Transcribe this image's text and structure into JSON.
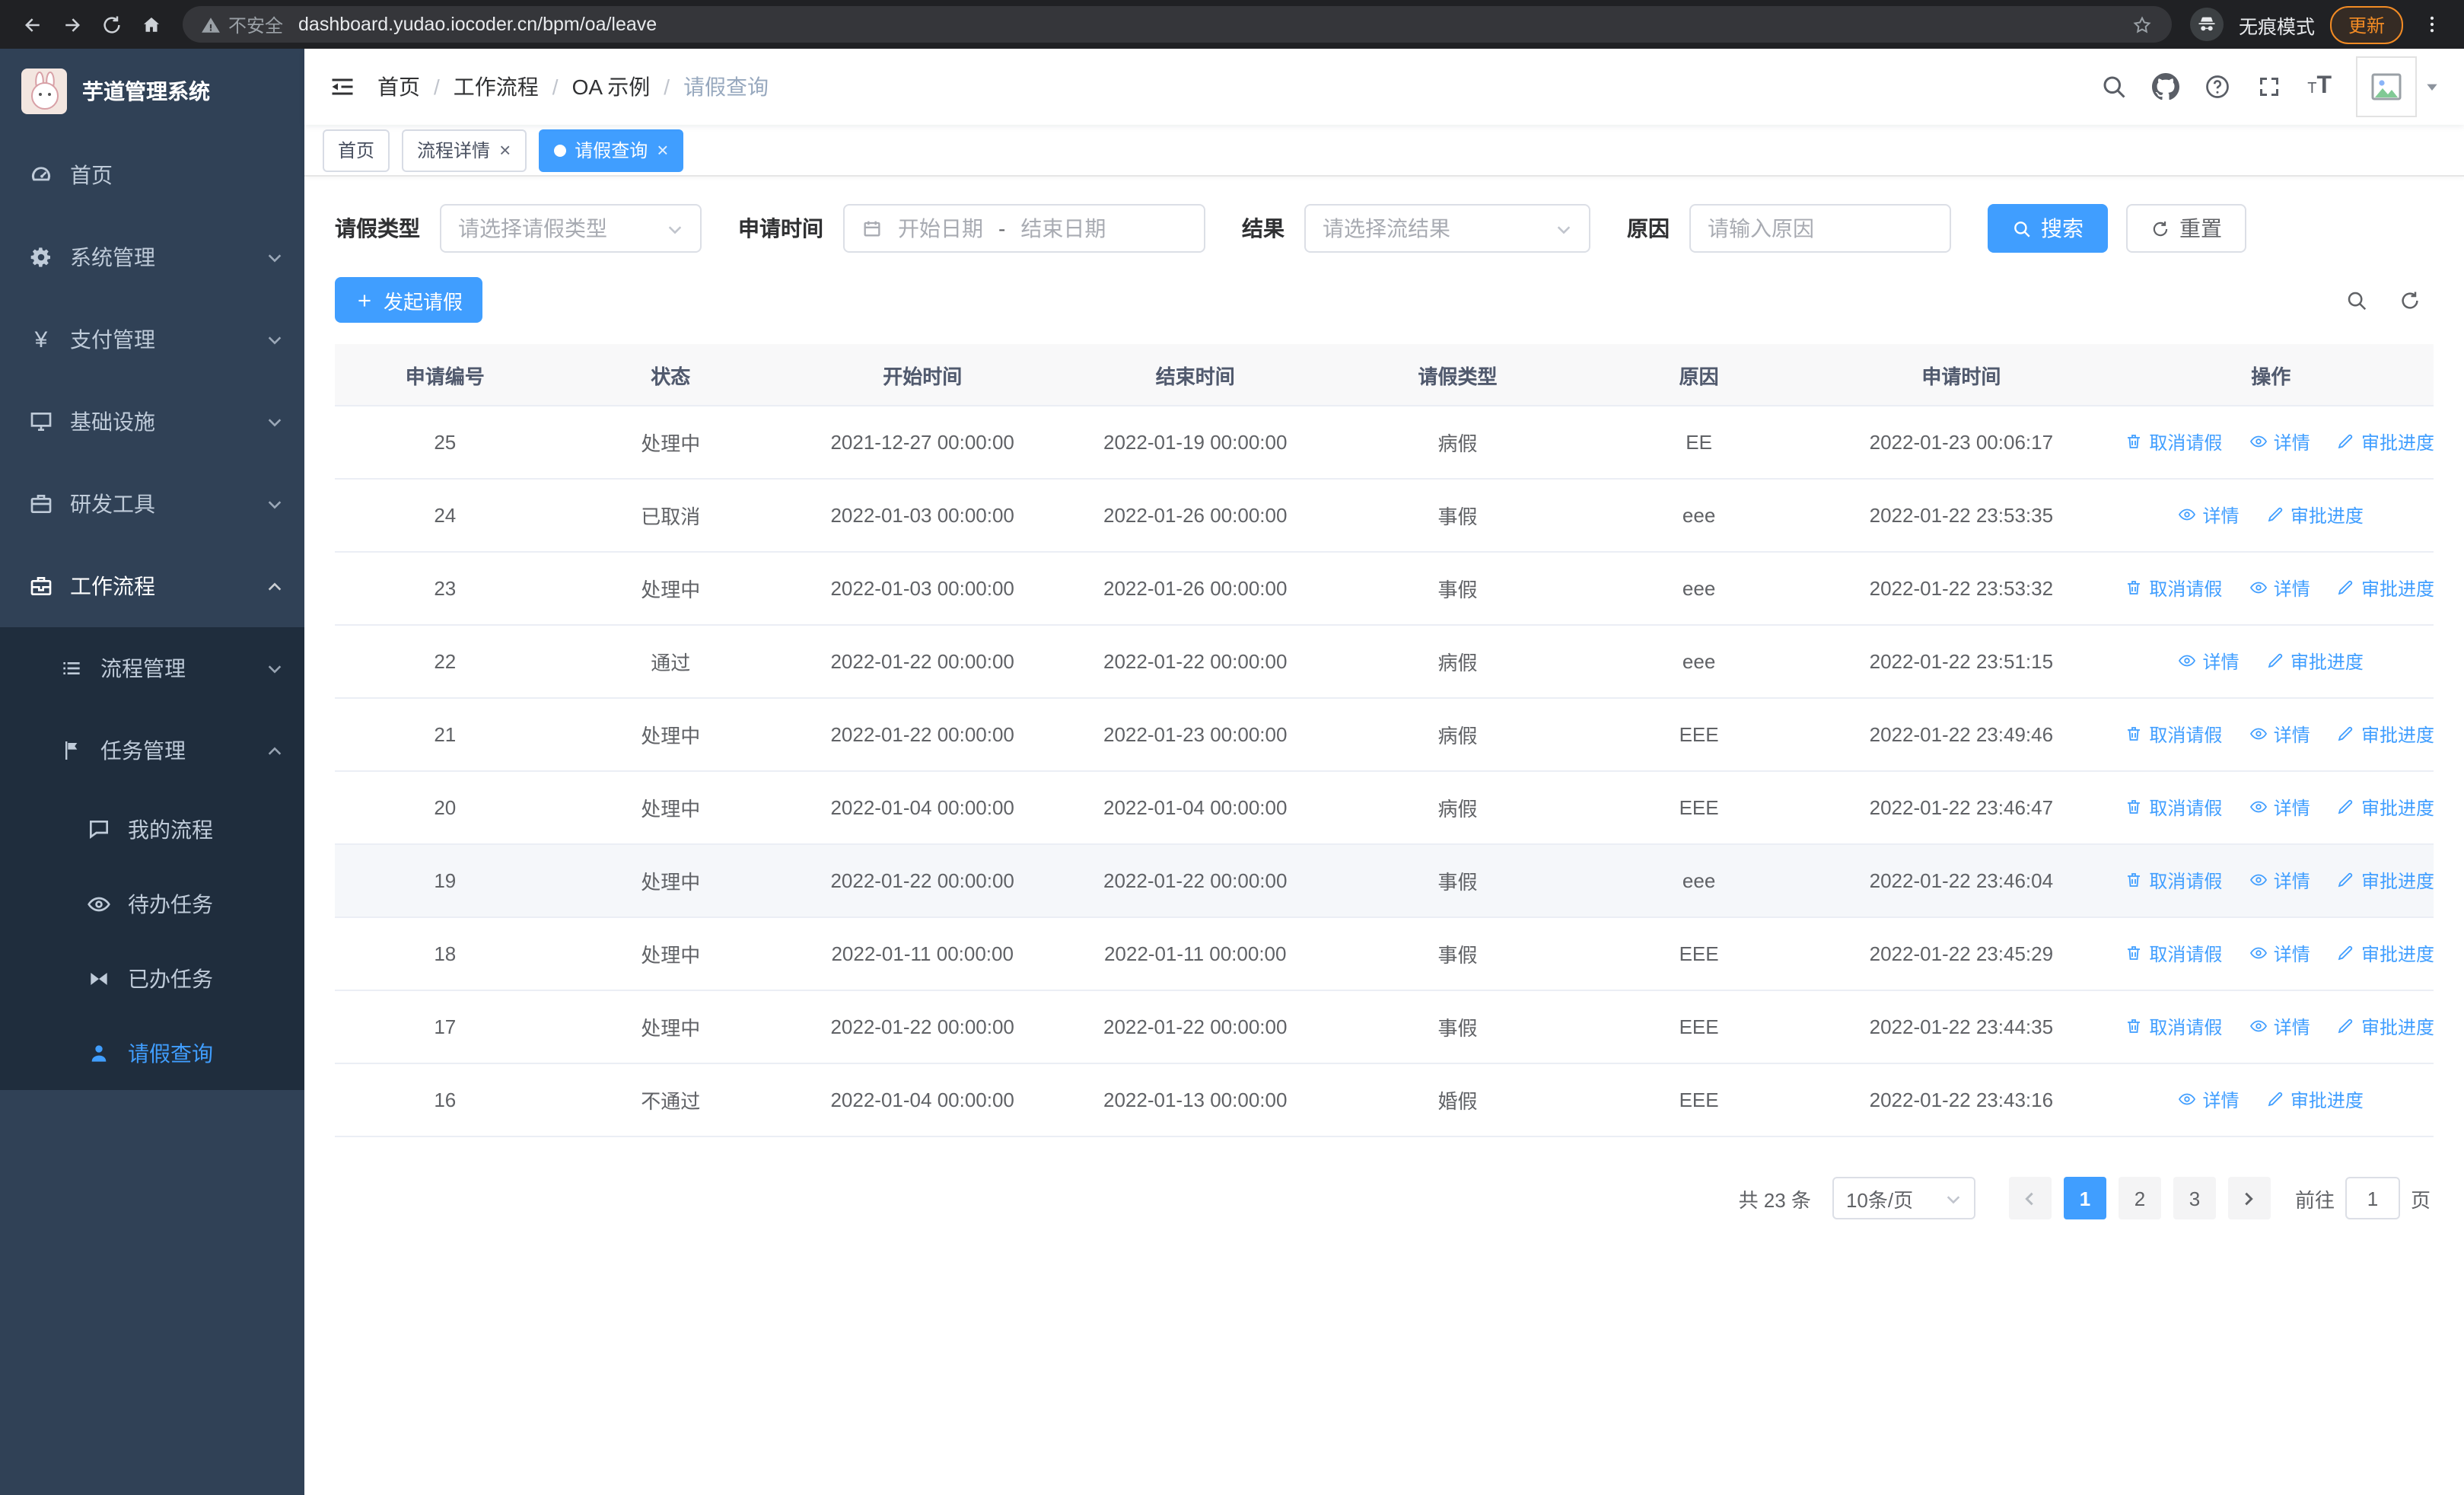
{
  "browser": {
    "security_label": "不安全",
    "url": "dashboard.yudao.iocoder.cn/bpm/oa/leave",
    "incognito_label": "无痕模式",
    "update_label": "更新"
  },
  "sidebar": {
    "logo_title": "芋道管理系统",
    "items": [
      {
        "label": "首页"
      },
      {
        "label": "系统管理"
      },
      {
        "label": "支付管理"
      },
      {
        "label": "基础设施"
      },
      {
        "label": "研发工具"
      },
      {
        "label": "工作流程"
      }
    ],
    "children": [
      {
        "label": "流程管理"
      },
      {
        "label": "任务管理"
      }
    ],
    "task_children": [
      {
        "label": "我的流程"
      },
      {
        "label": "待办任务"
      },
      {
        "label": "已办任务"
      },
      {
        "label": "请假查询"
      }
    ]
  },
  "header": {
    "breadcrumb": [
      "首页",
      "工作流程",
      "OA 示例",
      "请假查询"
    ],
    "separator": "/"
  },
  "tabs": [
    {
      "label": "首页"
    },
    {
      "label": "流程详情"
    },
    {
      "label": "请假查询"
    }
  ],
  "filters": {
    "leave_type_label": "请假类型",
    "leave_type_placeholder": "请选择请假类型",
    "apply_time_label": "申请时间",
    "start_date_placeholder": "开始日期",
    "range_separator": "-",
    "end_date_placeholder": "结束日期",
    "result_label": "结果",
    "result_placeholder": "请选择流结果",
    "reason_label": "原因",
    "reason_placeholder": "请输入原因",
    "search_label": "搜索",
    "reset_label": "重置"
  },
  "toolbar": {
    "create_label": "发起请假"
  },
  "table": {
    "columns": [
      "申请编号",
      "状态",
      "开始时间",
      "结束时间",
      "请假类型",
      "原因",
      "申请时间",
      "操作"
    ],
    "actions": {
      "cancel": "取消请假",
      "detail": "详情",
      "progress": "审批进度"
    },
    "rows": [
      {
        "id": "25",
        "status": "处理中",
        "start": "2021-12-27 00:00:00",
        "end": "2022-01-19 00:00:00",
        "type": "病假",
        "reason": "EE",
        "apply_time": "2022-01-23 00:06:17",
        "cancelable": true,
        "highlighted": false
      },
      {
        "id": "24",
        "status": "已取消",
        "start": "2022-01-03 00:00:00",
        "end": "2022-01-26 00:00:00",
        "type": "事假",
        "reason": "eee",
        "apply_time": "2022-01-22 23:53:35",
        "cancelable": false,
        "highlighted": false
      },
      {
        "id": "23",
        "status": "处理中",
        "start": "2022-01-03 00:00:00",
        "end": "2022-01-26 00:00:00",
        "type": "事假",
        "reason": "eee",
        "apply_time": "2022-01-22 23:53:32",
        "cancelable": true,
        "highlighted": false
      },
      {
        "id": "22",
        "status": "通过",
        "start": "2022-01-22 00:00:00",
        "end": "2022-01-22 00:00:00",
        "type": "病假",
        "reason": "eee",
        "apply_time": "2022-01-22 23:51:15",
        "cancelable": false,
        "highlighted": false
      },
      {
        "id": "21",
        "status": "处理中",
        "start": "2022-01-22 00:00:00",
        "end": "2022-01-23 00:00:00",
        "type": "病假",
        "reason": "EEE",
        "apply_time": "2022-01-22 23:49:46",
        "cancelable": true,
        "highlighted": false
      },
      {
        "id": "20",
        "status": "处理中",
        "start": "2022-01-04 00:00:00",
        "end": "2022-01-04 00:00:00",
        "type": "病假",
        "reason": "EEE",
        "apply_time": "2022-01-22 23:46:47",
        "cancelable": true,
        "highlighted": false
      },
      {
        "id": "19",
        "status": "处理中",
        "start": "2022-01-22 00:00:00",
        "end": "2022-01-22 00:00:00",
        "type": "事假",
        "reason": "eee",
        "apply_time": "2022-01-22 23:46:04",
        "cancelable": true,
        "highlighted": true
      },
      {
        "id": "18",
        "status": "处理中",
        "start": "2022-01-11 00:00:00",
        "end": "2022-01-11 00:00:00",
        "type": "事假",
        "reason": "EEE",
        "apply_time": "2022-01-22 23:45:29",
        "cancelable": true,
        "highlighted": false
      },
      {
        "id": "17",
        "status": "处理中",
        "start": "2022-01-22 00:00:00",
        "end": "2022-01-22 00:00:00",
        "type": "事假",
        "reason": "EEE",
        "apply_time": "2022-01-22 23:44:35",
        "cancelable": true,
        "highlighted": false
      },
      {
        "id": "16",
        "status": "不通过",
        "start": "2022-01-04 00:00:00",
        "end": "2022-01-13 00:00:00",
        "type": "婚假",
        "reason": "EEE",
        "apply_time": "2022-01-22 23:43:16",
        "cancelable": false,
        "highlighted": false
      }
    ]
  },
  "pagination": {
    "total_label": "共 23 条",
    "page_size": "10条/页",
    "pages": [
      "1",
      "2",
      "3"
    ],
    "active_page": "1",
    "goto_label": "前往",
    "goto_value": "1",
    "page_unit": "页"
  },
  "colors": {
    "primary": "#409eff",
    "sidebar_bg": "#304156",
    "submenu_bg": "#1f2d3d",
    "update_accent": "#f28b24"
  }
}
